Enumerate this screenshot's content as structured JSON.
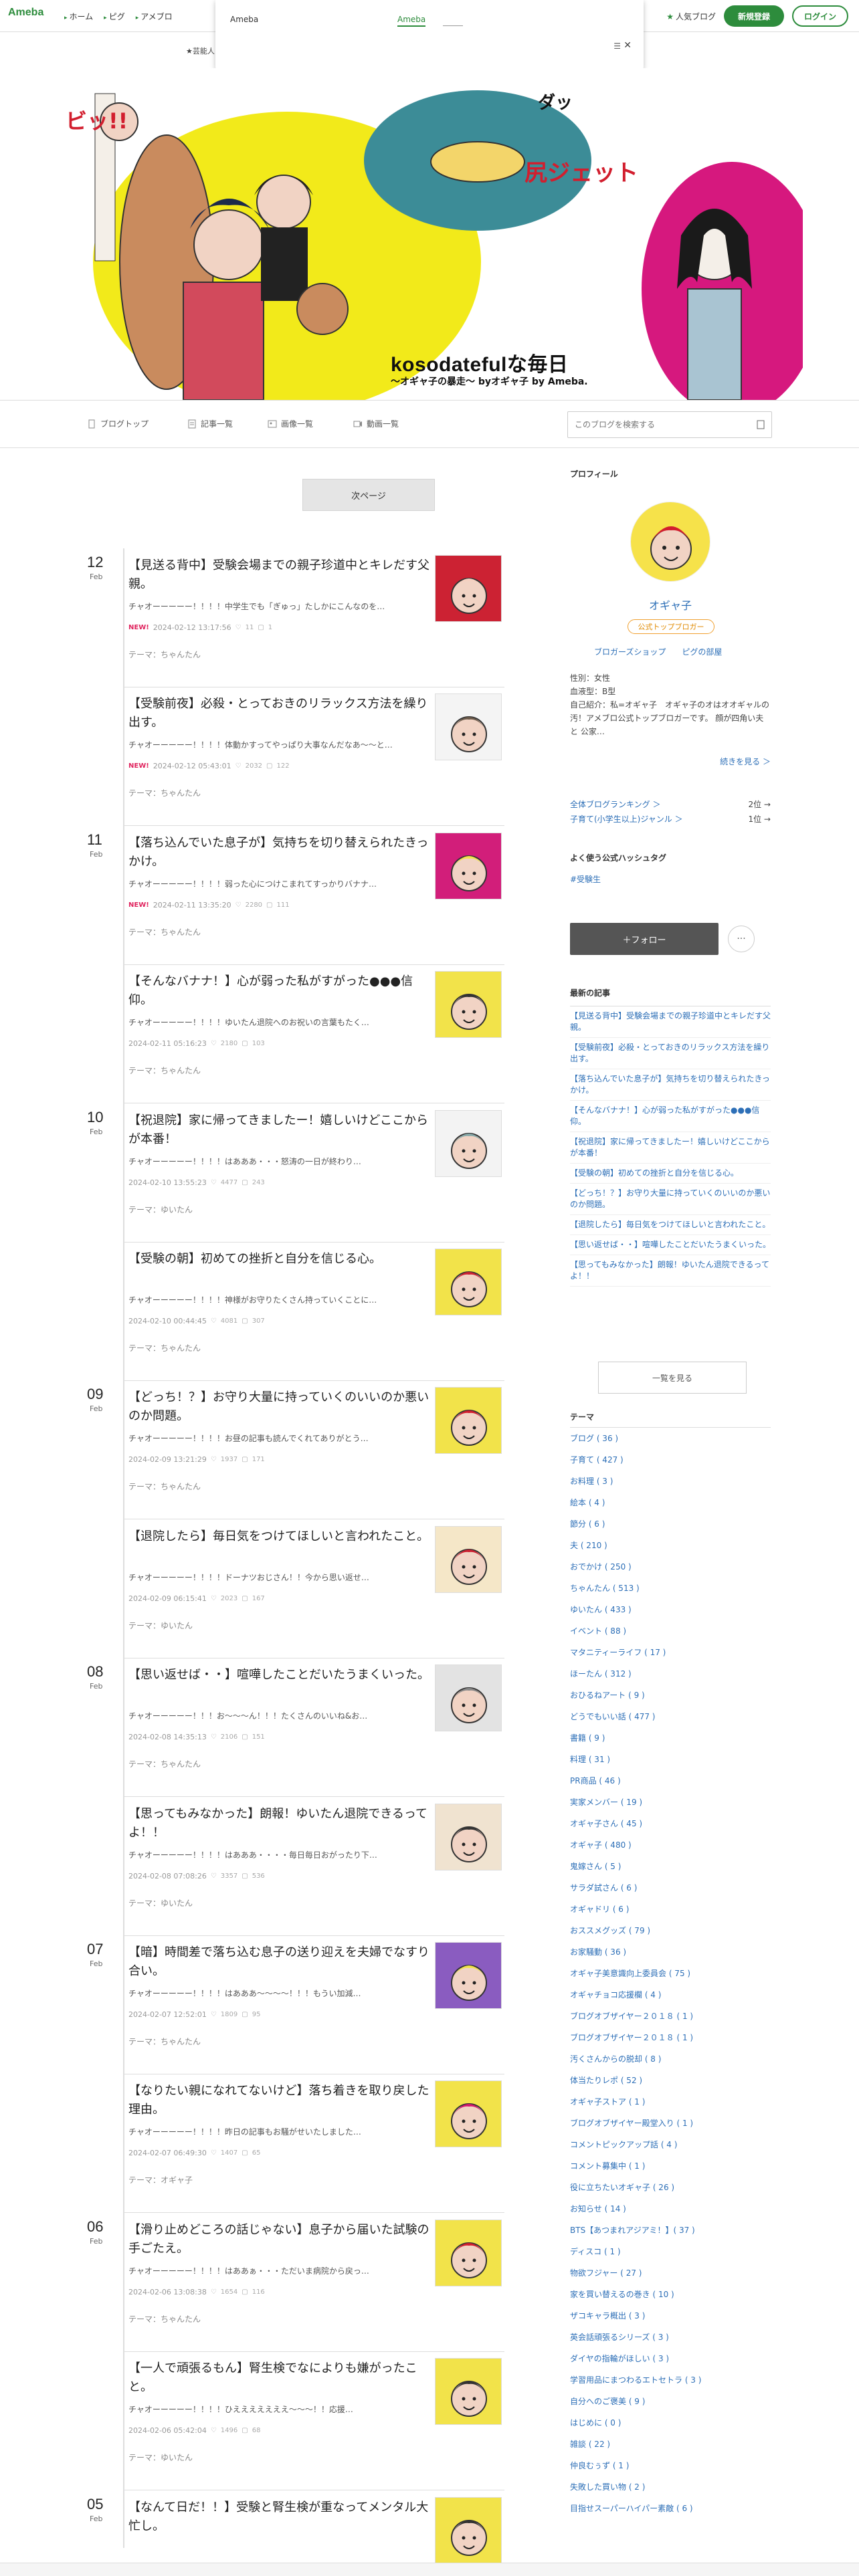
{
  "header": {
    "logo": "Ameba",
    "nav": [
      "ホーム",
      "ピグ",
      "アメブロ"
    ],
    "popular_blog": "人気ブログ",
    "register": "新規登録",
    "login": "ログイン"
  },
  "sub_tab": "★芸能人",
  "popup": {
    "title": "Ameba",
    "link": "Ameba",
    "close": "✕",
    "menu": "☰"
  },
  "hero": {
    "title": "kosodatefulな毎日",
    "subtitle": "〜オギャ子の暴走〜 byオギャ子 by Ameba."
  },
  "blog_nav": {
    "items": [
      "ブログトップ",
      "記事一覧",
      "画像一覧",
      "動画一覧"
    ],
    "search_placeholder": "このブログを検索する"
  },
  "next_page": "次ページ",
  "entries": [
    {
      "day": "12",
      "mon": "Feb",
      "title": "【見送る背中】受験会場までの親子珍道中とキレだす父親。",
      "excerpt": "チャオーーーーー！！！！中学生でも「ぎゅっ」たしかにこんなのを…",
      "new": "NEW!",
      "date": "2024-02-12 13:17:56",
      "c1": "11",
      "c2": "1",
      "theme": "テーマ：ちゃんたん"
    },
    {
      "day": "",
      "mon": "",
      "title": "【受験前夜】必殺・とっておきのリラックス方法を繰り出す。",
      "excerpt": "チャオーーーーー！！！！体動かすってやっぱり大事なんだなあ〜〜と…",
      "new": "NEW!",
      "date": "2024-02-12 05:43:01",
      "c1": "2032",
      "c2": "122",
      "theme": "テーマ：ちゃんたん"
    },
    {
      "day": "11",
      "mon": "Feb",
      "title": "【落ち込んでいた息子が】気持ちを切り替えられたきっかけ。",
      "excerpt": "チャオーーーーー！！！！弱った心につけこまれてすっかりバナナ…",
      "new": "NEW!",
      "date": "2024-02-11 13:35:20",
      "c1": "2280",
      "c2": "111",
      "theme": "テーマ：ちゃんたん"
    },
    {
      "day": "",
      "mon": "",
      "title": "【そんなバナナ！】心が弱った私がすがった●●●信仰。",
      "excerpt": "チャオーーーーー！！！！ゆいたん退院へのお祝いの言葉もたく…",
      "new": "",
      "date": "2024-02-11 05:16:23",
      "c1": "2180",
      "c2": "103",
      "theme": "テーマ：ちゃんたん"
    },
    {
      "day": "10",
      "mon": "Feb",
      "title": "【祝退院】家に帰ってきましたー！嬉しいけどここからが本番！",
      "excerpt": "チャオーーーーー！！！！はあああ・・・怒涛の一日が終わり…",
      "new": "",
      "date": "2024-02-10 13:55:23",
      "c1": "4477",
      "c2": "243",
      "theme": "テーマ：ゆいたん"
    },
    {
      "day": "",
      "mon": "",
      "title": "【受験の朝】初めての挫折と自分を信じる心。",
      "excerpt": "チャオーーーーー！！！！神様がお守りたくさん持っていくことに…",
      "new": "",
      "date": "2024-02-10 00:44:45",
      "c1": "4081",
      "c2": "307",
      "theme": "テーマ：ちゃんたん"
    },
    {
      "day": "09",
      "mon": "Feb",
      "title": "【どっち！？】お守り大量に持っていくのいいのか悪いのか問題。",
      "excerpt": "チャオーーーーー！！！！お昼の記事も読んでくれてありがとう…",
      "new": "",
      "date": "2024-02-09 13:21:29",
      "c1": "1937",
      "c2": "171",
      "theme": "テーマ：ちゃんたん"
    },
    {
      "day": "",
      "mon": "",
      "title": "【退院したら】毎日気をつけてほしいと言われたこと。",
      "excerpt": "チャオーーーーー！！！！ドーナツおじさん！！今から思い返せ…",
      "new": "",
      "date": "2024-02-09 06:15:41",
      "c1": "2023",
      "c2": "167",
      "theme": "テーマ：ゆいたん"
    },
    {
      "day": "08",
      "mon": "Feb",
      "title": "【思い返せば・・】喧嘩したことだいたうまくいった。",
      "excerpt": "チャオーーーーー！！！お〜〜〜ん！！！たくさんのいいね&お…",
      "new": "",
      "date": "2024-02-08 14:35:13",
      "c1": "2106",
      "c2": "151",
      "theme": "テーマ：ちゃんたん"
    },
    {
      "day": "",
      "mon": "",
      "title": "【思ってもみなかった】朗報！ゆいたん退院できるってよ！！",
      "excerpt": "チャオーーーーー！！！！はあああ・・・・毎日毎日おがったり下…",
      "new": "",
      "date": "2024-02-08 07:08:26",
      "c1": "3357",
      "c2": "536",
      "theme": "テーマ：ゆいたん"
    },
    {
      "day": "07",
      "mon": "Feb",
      "title": "【暗】時間差で落ち込む息子の送り迎えを夫婦でなすり合い。",
      "excerpt": "チャオーーーーー！！！！はあああ〜〜〜〜！！！もうい加減…",
      "new": "",
      "date": "2024-02-07 12:52:01",
      "c1": "1809",
      "c2": "95",
      "theme": "テーマ：ちゃんたん"
    },
    {
      "day": "",
      "mon": "",
      "title": "【なりたい親になれてないけど】落ち着きを取り戻した理由。",
      "excerpt": "チャオーーーーー！！！！昨日の記事もお騒がせいたしました…",
      "new": "",
      "date": "2024-02-07 06:49:30",
      "c1": "1407",
      "c2": "65",
      "theme": "テーマ：オギャ子"
    },
    {
      "day": "06",
      "mon": "Feb",
      "title": "【滑り止めどころの話じゃない】息子から届いた試験の手ごたえ。",
      "excerpt": "チャオーーーーー！！！！はああぁ・・・ただいま病院から戻っ…",
      "new": "",
      "date": "2024-02-06 13:08:38",
      "c1": "1654",
      "c2": "116",
      "theme": "テーマ：ちゃんたん"
    },
    {
      "day": "",
      "mon": "",
      "title": "【一人で頑張るもん】腎生検でなによりも嫌がったこと。",
      "excerpt": "チャオーーーーー！！！！ひえええええええ〜〜〜！！応援…",
      "new": "",
      "date": "2024-02-06 05:42:04",
      "c1": "1496",
      "c2": "68",
      "theme": "テーマ：ゆいたん"
    },
    {
      "day": "05",
      "mon": "Feb",
      "title": "【なんて日だ！！】受験と腎生検が重なってメンタル大忙し。",
      "excerpt": "",
      "new": "",
      "date": "",
      "c1": "",
      "c2": "",
      "theme": ""
    }
  ],
  "sidebar": {
    "profile_heading": "プロフィール",
    "name": "オギャ子",
    "official_badge": "公式トップブロガー",
    "links": [
      "ブロガーズショップ",
      "ピグの部屋"
    ],
    "info": [
      "性別：女性",
      "血液型：B型",
      "自己紹介：私=オギャ子　オギャ子のオはオオギャルの汚！アメブロ公式トップブロガーです。 顔が四角い夫と 公家…"
    ],
    "more": "続きを見る ＞",
    "ranking": [
      {
        "label": "全体ブログランキング ＞",
        "value": "2位 →"
      },
      {
        "label": "子育て(小学生以上)ジャンル ＞",
        "value": "1位 →"
      }
    ],
    "hashtag_heading": "よく使う公式ハッシュタグ",
    "hashtag": "#受験生",
    "follow": "＋フォロー",
    "more_btn": "···",
    "latest_heading": "最新の記事",
    "latest": [
      "【見送る背中】受験会場までの親子珍道中とキレだす父親。",
      "【受験前夜】必殺・とっておきのリラックス方法を繰り出す。",
      "【落ち込んでいた息子が】気持ちを切り替えられたきっかけ。",
      "【そんなバナナ！】心が弱った私がすがった●●●信仰。",
      "【祝退院】家に帰ってきましたー！嬉しいけどここからが本番！",
      "【受験の朝】初めての挫折と自分を信じる心。",
      "【どっち！？】お守り大量に持っていくのいいのか悪いのか問題。",
      "【退院したら】毎日気をつけてほしいと言われたこと。",
      "【思い返せば・・】喧嘩したことだいたうまくいった。",
      "【思ってもみなかった】朗報！ゆいたん退院できるってよ！！"
    ],
    "list_btn": "一覧を見る",
    "themes_heading": "テーマ",
    "themes": [
      "ブログ ( 36 )",
      "子育て ( 427 )",
      "お料理 ( 3 )",
      "絵本 ( 4 )",
      "節分 ( 6 )",
      "夫 ( 210 )",
      "おでかけ ( 250 )",
      "ちゃんたん ( 513 )",
      "ゆいたん ( 433 )",
      "イベント ( 88 )",
      "マタニティーライフ ( 17 )",
      "ほーたん ( 312 )",
      "おひるねアート ( 9 )",
      "どうでもいい話 ( 477 )",
      "書籍 ( 9 )",
      "料理 ( 31 )",
      "PR商品 ( 46 )",
      "実家メンバー ( 19 )",
      "オギャ子さん ( 45 )",
      "オギャ子 ( 480 )",
      "鬼嫁さん ( 5 )",
      "サラダ試さん ( 6 )",
      "オギャドリ ( 6 )",
      "おススメグッズ ( 79 )",
      "お家騒動 ( 36 )",
      "オギャ子美意識向上委員会 ( 75 )",
      "オギャチョコ応援欄 ( 4 )",
      "ブログオブザイヤー２０１８ ( 1 )",
      "ブログオブザイヤー２０１８ ( 1 )",
      "汚くさんからの脱却 ( 8 )",
      "体当たりレポ ( 52 )",
      "オギャ子ストア ( 1 )",
      "ブログオブザイヤー殿堂入り ( 1 )",
      "コメントピックアップ話 ( 4 )",
      "コメント募集中 ( 1 )",
      "役に立ちたいオギャ子 ( 26 )",
      "お知らせ ( 14 )",
      "BTS【あつまれアジアミ！】( 37 )",
      "ディスコ ( 1 )",
      "物欲フジャー ( 27 )",
      "家を買い替えるの巻き ( 10 )",
      "ザコキャラ概出 ( 3 )",
      "英会話頑張るシリーズ ( 3 )",
      "ダイヤの指輪がほしい ( 3 )",
      "学習用品にまつわるエトセトラ ( 3 )",
      "自分へのご褒美 ( 9 )",
      "はじめに ( 0 )",
      "雑談 ( 22 )",
      "仲良むぅず ( 1 )",
      "失敗した買い物 ( 2 )",
      "目指せスーパーハイパー素敵 ( 6 )"
    ]
  }
}
